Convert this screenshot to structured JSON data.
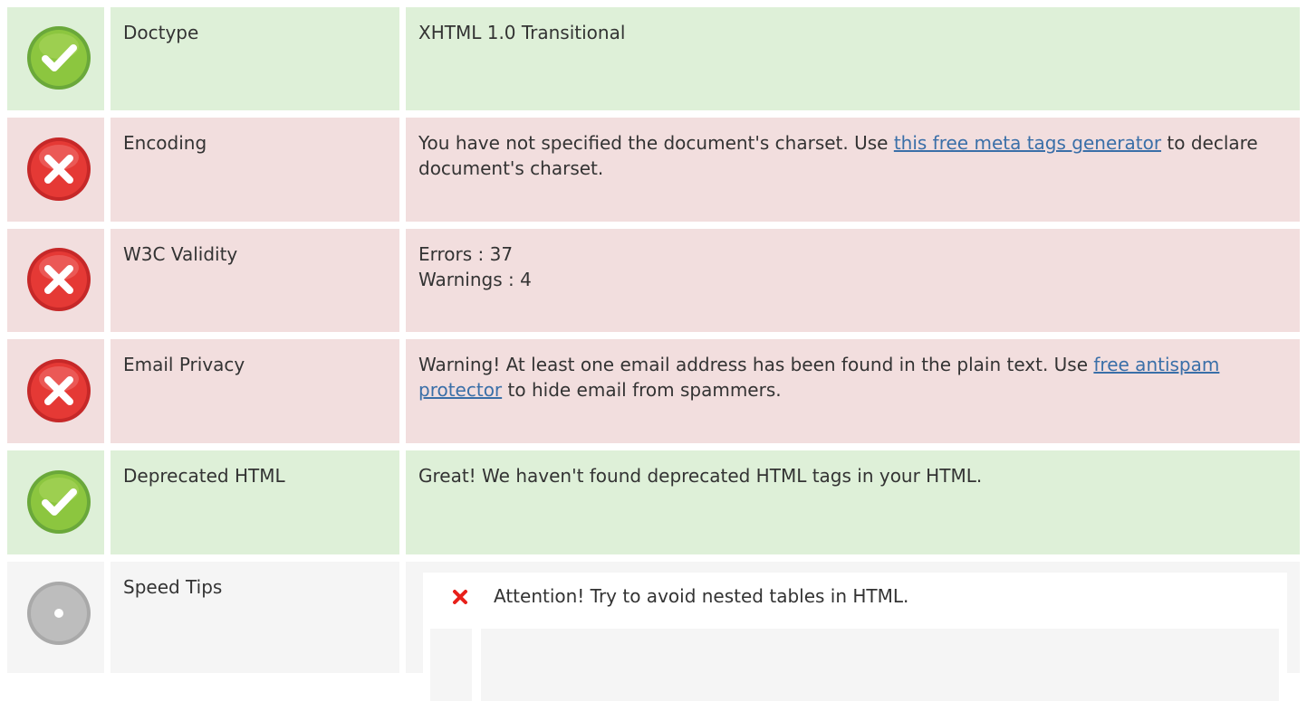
{
  "colors": {
    "ok_bg": "#def0d8",
    "bad_bg": "#f2dede",
    "neutral_bg": "#f5f5f5",
    "link": "#3a6fa8",
    "ok_icon": "#7cb342",
    "bad_icon": "#e53935",
    "neutral_icon": "#b0b0b0"
  },
  "rows": [
    {
      "status": "ok",
      "icon": "check-circle-icon",
      "label": "Doctype",
      "value": "XHTML 1.0 Transitional"
    },
    {
      "status": "error",
      "icon": "x-circle-icon",
      "label": "Encoding",
      "text_before": "You have not specified the document's charset. Use ",
      "link_text": "this free meta tags generator",
      "text_after": " to declare document's charset."
    },
    {
      "status": "error",
      "icon": "x-circle-icon",
      "label": "W3C Validity",
      "line1": "Errors : 37",
      "line2": "Warnings : 4"
    },
    {
      "status": "error",
      "icon": "x-circle-icon",
      "label": "Email Privacy",
      "text_before": "Warning! At least one email address has been found in the plain text. Use ",
      "link_text": "free antispam protector",
      "text_after": " to hide email from spammers."
    },
    {
      "status": "ok",
      "icon": "check-circle-icon",
      "label": "Deprecated HTML",
      "value": "Great! We haven't found deprecated HTML tags in your HTML."
    },
    {
      "status": "neutral",
      "icon": "neutral-circle-icon",
      "label": "Speed Tips",
      "tip_icon": "x-mark-icon",
      "tip_text": "Attention! Try to avoid nested tables in HTML."
    }
  ]
}
